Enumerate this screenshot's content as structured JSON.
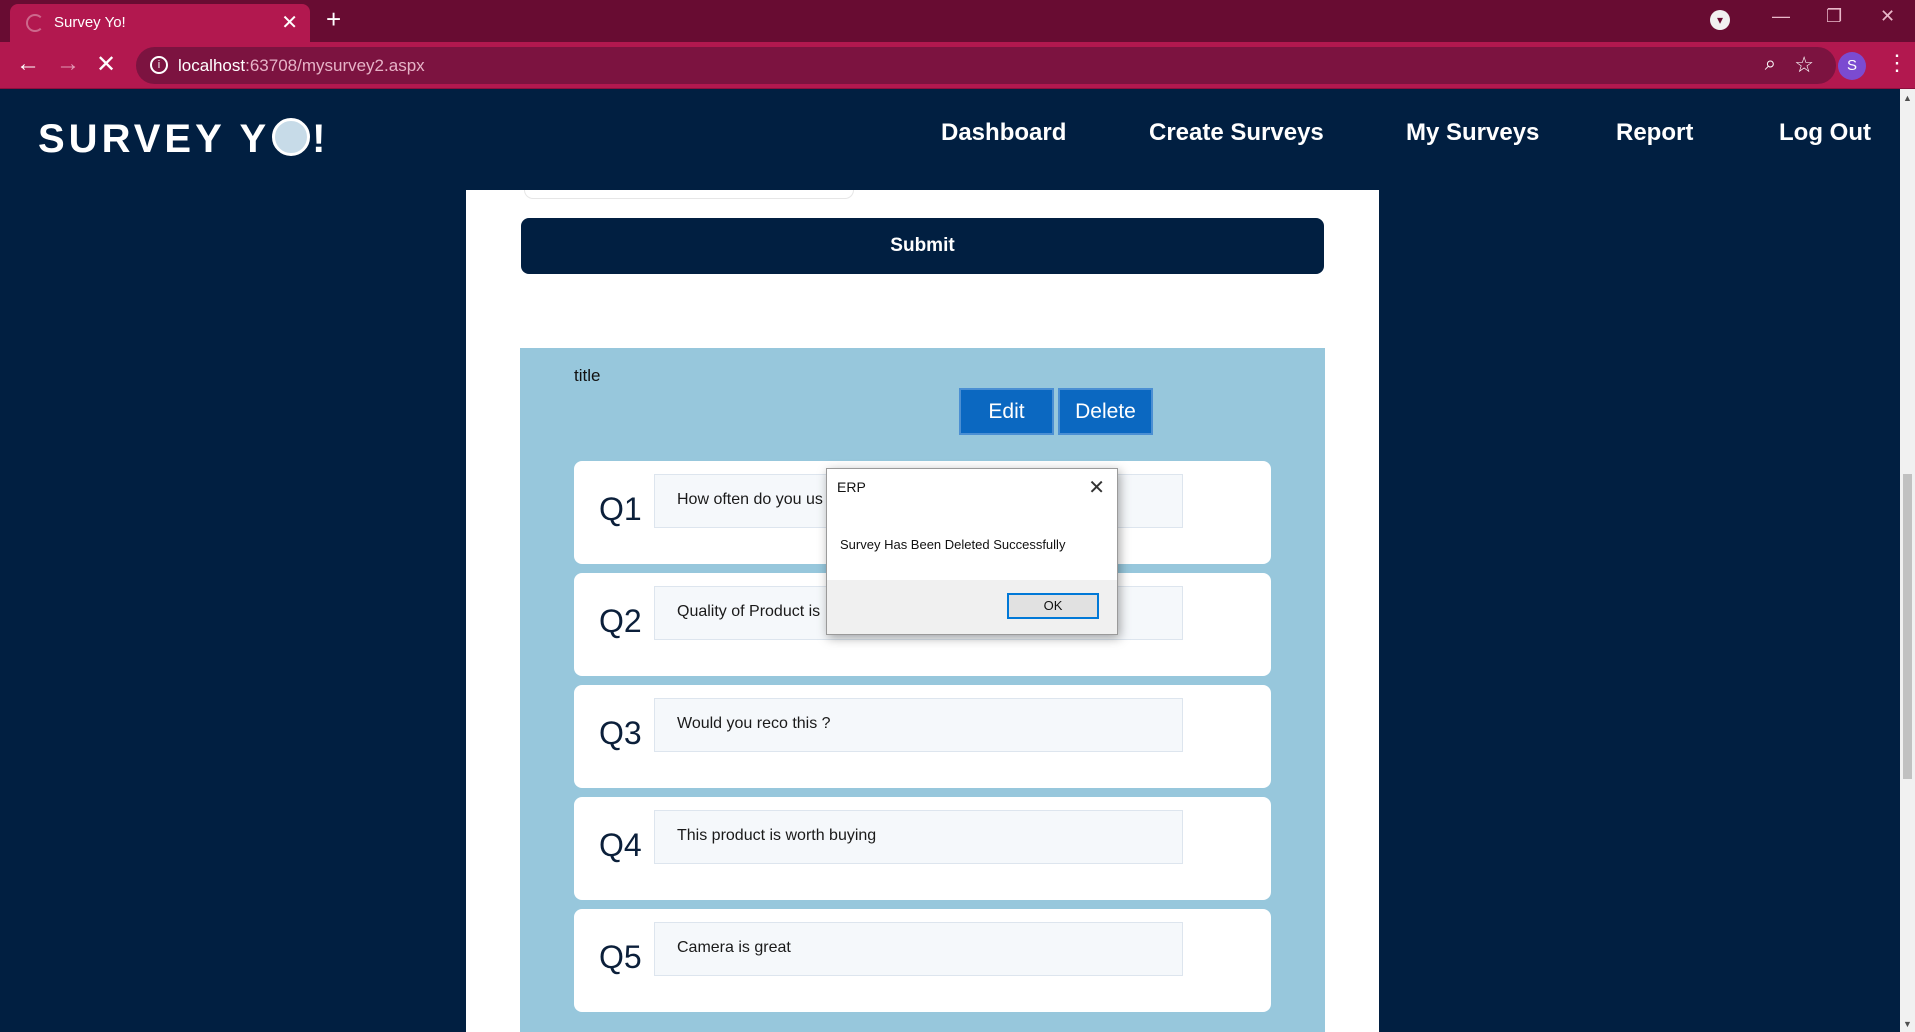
{
  "browser": {
    "tab_title": "Survey Yo!",
    "tab_close": "✕",
    "new_tab": "+",
    "url_host": "localhost",
    "url_path": ":63708/mysurvey2.aspx",
    "profile_initial": "S",
    "accent": "#b2184f"
  },
  "site": {
    "logo_prefix": "SURVEY Y",
    "logo_suffix": "!",
    "nav": [
      "Dashboard",
      "Create Surveys",
      "My Surveys",
      "Report",
      "Log Out"
    ]
  },
  "form": {
    "submit_label": "Submit"
  },
  "survey": {
    "title": "title",
    "edit_label": "Edit",
    "delete_label": "Delete",
    "questions": [
      {
        "num": "Q1",
        "text": "How often do you us"
      },
      {
        "num": "Q2",
        "text": "Quality of Product is"
      },
      {
        "num": "Q3",
        "text": "Would you reco this ?"
      },
      {
        "num": "Q4",
        "text": "This product is worth buying"
      },
      {
        "num": "Q5",
        "text": "Camera is great"
      }
    ]
  },
  "dialog": {
    "title": "ERP",
    "message": "Survey Has Been Deleted Successfully",
    "ok_label": "OK"
  }
}
